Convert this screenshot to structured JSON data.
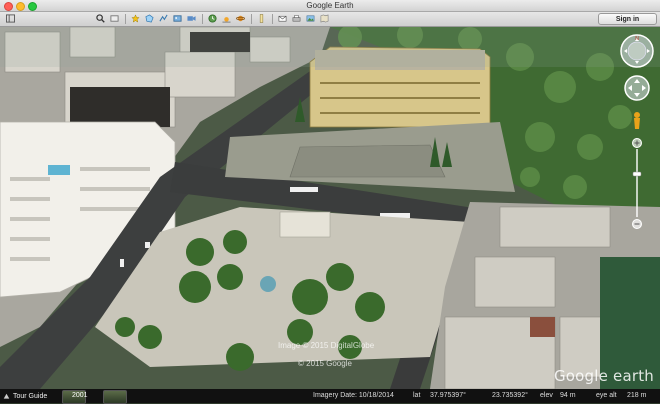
{
  "window": {
    "title": "Google Earth"
  },
  "toolbar": {
    "icons": [
      "sidebar-icon",
      "search-icon",
      "hide-panel-icon",
      "placemark-icon",
      "polygon-icon",
      "path-icon",
      "overlay-icon",
      "tour-icon",
      "historical-imagery-icon",
      "sunlight-icon",
      "planet-icon",
      "ruler-icon",
      "email-icon",
      "print-icon",
      "save-image-icon",
      "maps-icon"
    ],
    "sign_in_label": "Sign in"
  },
  "map": {
    "imagery_credit": "Image © 2015 DigitalGlobe",
    "copyright": "© 2015 Google",
    "logo": "Google earth"
  },
  "statusbar": {
    "tour_guide_label": "Tour Guide",
    "thumbnail_year": "2001",
    "imagery_date_label": "Imagery Date: 10/18/2014",
    "lat_label": "lat",
    "lat_value": "37.975397°",
    "lon_value": "23.735392°",
    "elev_label": "elev",
    "elev_value": "94 m",
    "eye_alt_label": "eye alt",
    "eye_alt_value": "218 m"
  },
  "colors": {
    "close": "#ff5f57",
    "minimize": "#febc2e",
    "zoom": "#28c840"
  }
}
